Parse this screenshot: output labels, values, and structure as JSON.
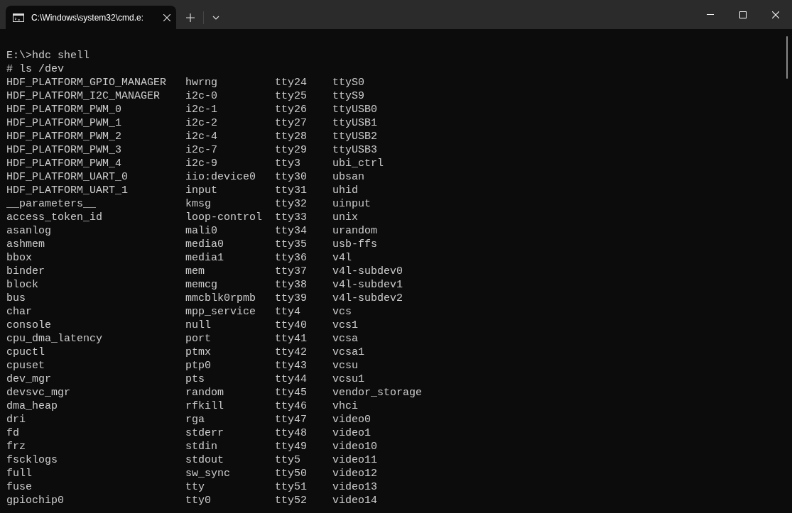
{
  "window": {
    "tab": {
      "title": "C:\\Windows\\system32\\cmd.e:",
      "selected": true
    }
  },
  "terminal": {
    "lines": [
      "E:\\>hdc shell",
      "# ls /dev"
    ],
    "ls_rows": [
      [
        "HDF_PLATFORM_GPIO_MANAGER",
        "hwrng",
        "tty24",
        "ttyS0"
      ],
      [
        "HDF_PLATFORM_I2C_MANAGER",
        "i2c-0",
        "tty25",
        "ttyS9"
      ],
      [
        "HDF_PLATFORM_PWM_0",
        "i2c-1",
        "tty26",
        "ttyUSB0"
      ],
      [
        "HDF_PLATFORM_PWM_1",
        "i2c-2",
        "tty27",
        "ttyUSB1"
      ],
      [
        "HDF_PLATFORM_PWM_2",
        "i2c-4",
        "tty28",
        "ttyUSB2"
      ],
      [
        "HDF_PLATFORM_PWM_3",
        "i2c-7",
        "tty29",
        "ttyUSB3"
      ],
      [
        "HDF_PLATFORM_PWM_4",
        "i2c-9",
        "tty3",
        "ubi_ctrl"
      ],
      [
        "HDF_PLATFORM_UART_0",
        "iio:device0",
        "tty30",
        "ubsan"
      ],
      [
        "HDF_PLATFORM_UART_1",
        "input",
        "tty31",
        "uhid"
      ],
      [
        "__parameters__",
        "kmsg",
        "tty32",
        "uinput"
      ],
      [
        "access_token_id",
        "loop-control",
        "tty33",
        "unix"
      ],
      [
        "asanlog",
        "mali0",
        "tty34",
        "urandom"
      ],
      [
        "ashmem",
        "media0",
        "tty35",
        "usb-ffs"
      ],
      [
        "bbox",
        "media1",
        "tty36",
        "v4l"
      ],
      [
        "binder",
        "mem",
        "tty37",
        "v4l-subdev0"
      ],
      [
        "block",
        "memcg",
        "tty38",
        "v4l-subdev1"
      ],
      [
        "bus",
        "mmcblk0rpmb",
        "tty39",
        "v4l-subdev2"
      ],
      [
        "char",
        "mpp_service",
        "tty4",
        "vcs"
      ],
      [
        "console",
        "null",
        "tty40",
        "vcs1"
      ],
      [
        "cpu_dma_latency",
        "port",
        "tty41",
        "vcsa"
      ],
      [
        "cpuctl",
        "ptmx",
        "tty42",
        "vcsa1"
      ],
      [
        "cpuset",
        "ptp0",
        "tty43",
        "vcsu"
      ],
      [
        "dev_mgr",
        "pts",
        "tty44",
        "vcsu1"
      ],
      [
        "devsvc_mgr",
        "random",
        "tty45",
        "vendor_storage"
      ],
      [
        "dma_heap",
        "rfkill",
        "tty46",
        "vhci"
      ],
      [
        "dri",
        "rga",
        "tty47",
        "video0"
      ],
      [
        "fd",
        "stderr",
        "tty48",
        "video1"
      ],
      [
        "frz",
        "stdin",
        "tty49",
        "video10"
      ],
      [
        "fscklogs",
        "stdout",
        "tty5",
        "video11"
      ],
      [
        "full",
        "sw_sync",
        "tty50",
        "video12"
      ],
      [
        "fuse",
        "tty",
        "tty51",
        "video13"
      ],
      [
        "gpiochip0",
        "tty0",
        "tty52",
        "video14"
      ]
    ]
  }
}
